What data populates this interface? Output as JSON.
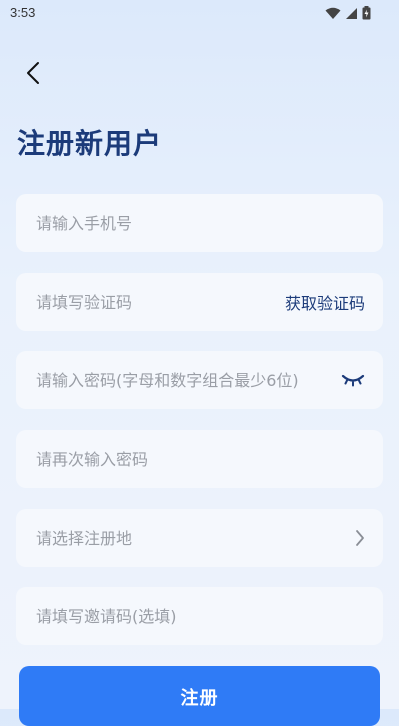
{
  "status_bar": {
    "time": "3:53"
  },
  "header": {
    "title": "注册新用户"
  },
  "form": {
    "phone_placeholder": "请输入手机号",
    "code_placeholder": "请填写验证码",
    "get_code_label": "获取验证码",
    "password_placeholder": "请输入密码(字母和数字组合最少6位)",
    "confirm_password_placeholder": "请再次输入密码",
    "region_placeholder": "请选择注册地",
    "invite_code_placeholder": "请填写邀请码(选填)"
  },
  "submit": {
    "label": "注册"
  },
  "colors": {
    "accent": "#2f7bf6",
    "title": "#1c3b7a",
    "field_bg": "#f5f8fd",
    "placeholder": "#9a9ea6"
  }
}
